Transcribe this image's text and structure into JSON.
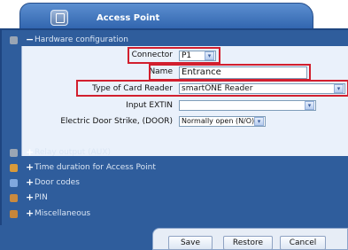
{
  "window": {
    "title": "Access Point",
    "icon": "access-point-icon"
  },
  "hardware": {
    "section_label": "Hardware configuration",
    "sign": "−",
    "connector": {
      "label": "Connector",
      "value": "P1"
    },
    "name": {
      "label": "Name",
      "value": "Entrance"
    },
    "card_reader": {
      "label": "Type of Card Reader",
      "value": "smartONE Reader"
    },
    "input_extin": {
      "label": "Input EXTIN",
      "value": ""
    },
    "door_strike": {
      "label": "Electric Door Strike, (DOOR)",
      "value": "Normally open (N/O)"
    }
  },
  "sections": [
    {
      "label": "Relay output (AUX)",
      "sign": "+"
    },
    {
      "label": "Time duration for Access Point",
      "sign": "+"
    },
    {
      "label": "Door codes",
      "sign": "+"
    },
    {
      "label": "PIN",
      "sign": "+"
    },
    {
      "label": "Miscellaneous",
      "sign": "+"
    }
  ],
  "buttons": {
    "save": "Save",
    "restore": "Restore",
    "cancel": "Cancel"
  },
  "dropdown_glyph": "▾",
  "colors": {
    "panel": "#2f5d9c",
    "highlight": "#d21f2e",
    "body": "#eaf1fb"
  }
}
